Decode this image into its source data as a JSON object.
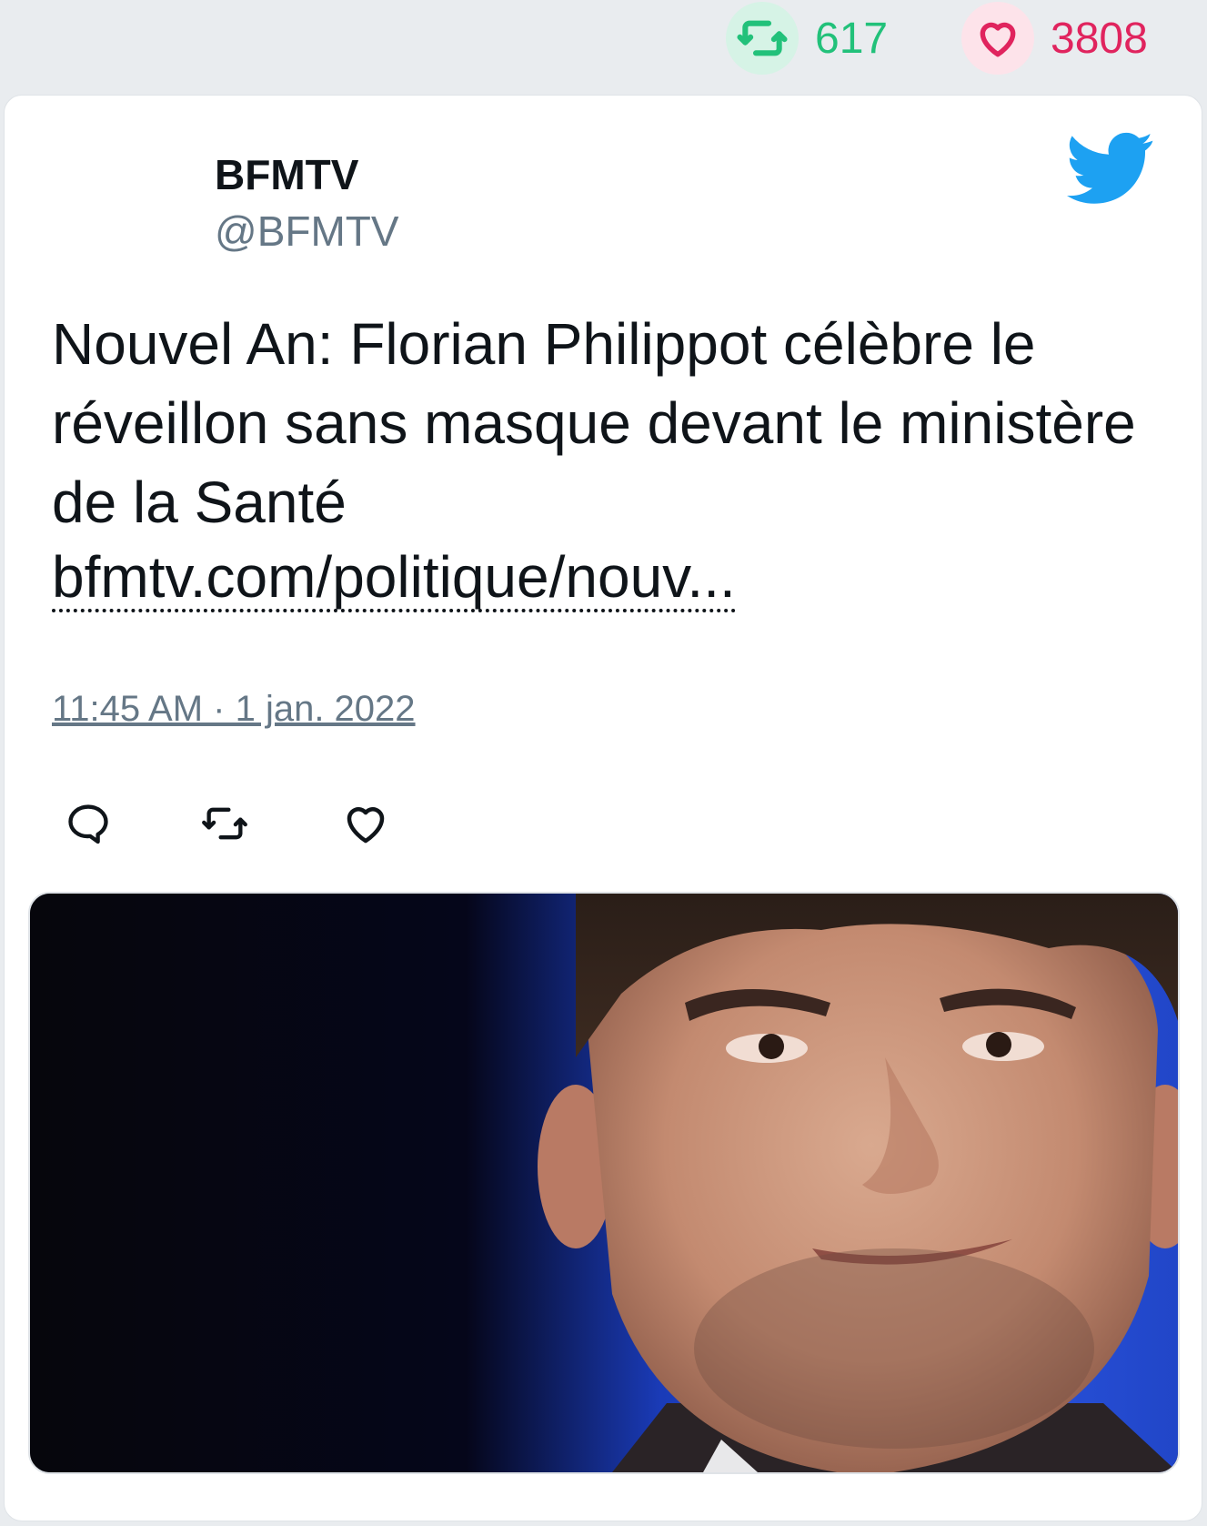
{
  "stats": {
    "retweets": "617",
    "likes": "3808",
    "retweet_color": "#22c17a",
    "like_color": "#e0245e"
  },
  "tweet": {
    "author_name": "BFMTV",
    "author_handle": "@BFMTV",
    "text": "Nouvel An: Florian Philippot célèbre le réveillon sans masque devant le ministère de la Santé",
    "link": "bfmtv.com/politique/nouv...",
    "timestamp": "11:45 AM · 1 jan. 2022"
  },
  "icons": {
    "brand": "twitter-bird-icon",
    "actions": [
      "reply-icon",
      "retweet-icon",
      "like-icon"
    ]
  },
  "colors": {
    "twitter_blue": "#1da1f2",
    "muted_text": "#657786"
  }
}
